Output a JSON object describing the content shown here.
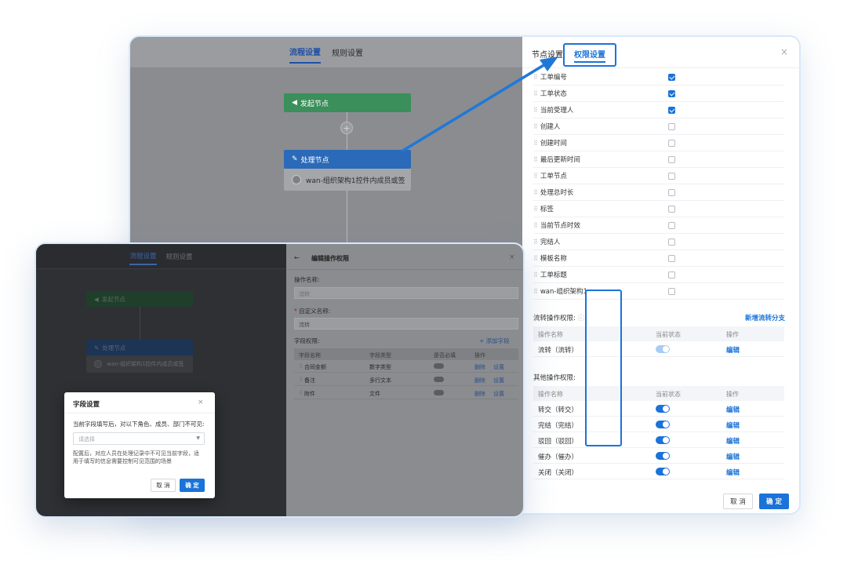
{
  "back_card": {
    "canvas": {
      "tabs": [
        "流程设置",
        "规则设置"
      ],
      "start_node": "发起节点",
      "plus": "+",
      "process_node": "处理节点",
      "process_assignee": "wan-组织架构1控件内成员或签"
    },
    "panel": {
      "tabs": [
        "节点设置",
        "权限设置"
      ],
      "close": "×",
      "fields": [
        {
          "name": "工单编号",
          "checked": true
        },
        {
          "name": "工单状态",
          "checked": true
        },
        {
          "name": "当前受理人",
          "checked": true
        },
        {
          "name": "创建人",
          "checked": false
        },
        {
          "name": "创建时间",
          "checked": false
        },
        {
          "name": "最后更新时间",
          "checked": false
        },
        {
          "name": "工单节点",
          "checked": false
        },
        {
          "name": "处理总时长",
          "checked": false
        },
        {
          "name": "标签",
          "checked": false
        },
        {
          "name": "当前节点时效",
          "checked": false
        },
        {
          "name": "完结人",
          "checked": false
        },
        {
          "name": "模板名称",
          "checked": false
        },
        {
          "name": "工单标题",
          "checked": false
        },
        {
          "name": "wan-组织架构1",
          "checked": false
        }
      ],
      "flow_perm": {
        "title": "流转操作权限:",
        "add_branch": "新增流转分支",
        "headers": [
          "操作名称",
          "当前状态",
          "操作"
        ],
        "rows": [
          {
            "name": "流转（流转）",
            "action": "编辑"
          }
        ]
      },
      "other_perm": {
        "title": "其他操作权限:",
        "headers": [
          "操作名称",
          "当前状态",
          "操作"
        ],
        "rows": [
          {
            "name": "转交（转交）",
            "action": "编辑"
          },
          {
            "name": "完结（完结）",
            "action": "编辑"
          },
          {
            "name": "驳回（驳回）",
            "action": "编辑"
          },
          {
            "name": "催办（催办）",
            "action": "编辑"
          },
          {
            "name": "关闭（关闭）",
            "action": "编辑"
          }
        ]
      },
      "buttons": {
        "cancel": "取 消",
        "confirm": "确 定"
      }
    }
  },
  "front_card": {
    "canvas": {
      "tabs": [
        "流程设置",
        "规则设置"
      ],
      "start_node": "发起节点",
      "process_node": "处理节点",
      "process_assignee": "wan-组织架构1控件内成员或签"
    },
    "panel": {
      "back": "←",
      "title": "编辑操作权限",
      "close": "×",
      "op_name_label": "操作名称:",
      "op_name_value": "流转",
      "custom_name_label": "自定义名称:",
      "custom_name_value": "流转",
      "field_perm_label": "字段权限:",
      "add_field": "+ 添加字段",
      "headers": [
        "字段名称",
        "字段类型",
        "是否必填",
        "操作"
      ],
      "rows": [
        {
          "name": "合同金额",
          "type": "数字类型",
          "delete": "删除",
          "settings": "设置"
        },
        {
          "name": "备注",
          "type": "多行文本",
          "delete": "删除",
          "settings": "设置"
        },
        {
          "name": "附件",
          "type": "文件",
          "delete": "删除",
          "settings": "设置"
        }
      ]
    },
    "dialog": {
      "title": "字段设置",
      "close": "×",
      "prompt": "当前字段填写后，对以下角色、成员、部门不可见:",
      "select_placeholder": "请选择",
      "note_line1": "配置后，对应人员在处理记录中不可见当前字段，适",
      "note_line2": "用于填写的信息需要控制可见范围的场景",
      "cancel": "取 消",
      "confirm": "确 定"
    }
  },
  "colors": {
    "accent": "#1a73d8",
    "start_node": "#3fae6a",
    "process_node": "#2f7fd8"
  }
}
